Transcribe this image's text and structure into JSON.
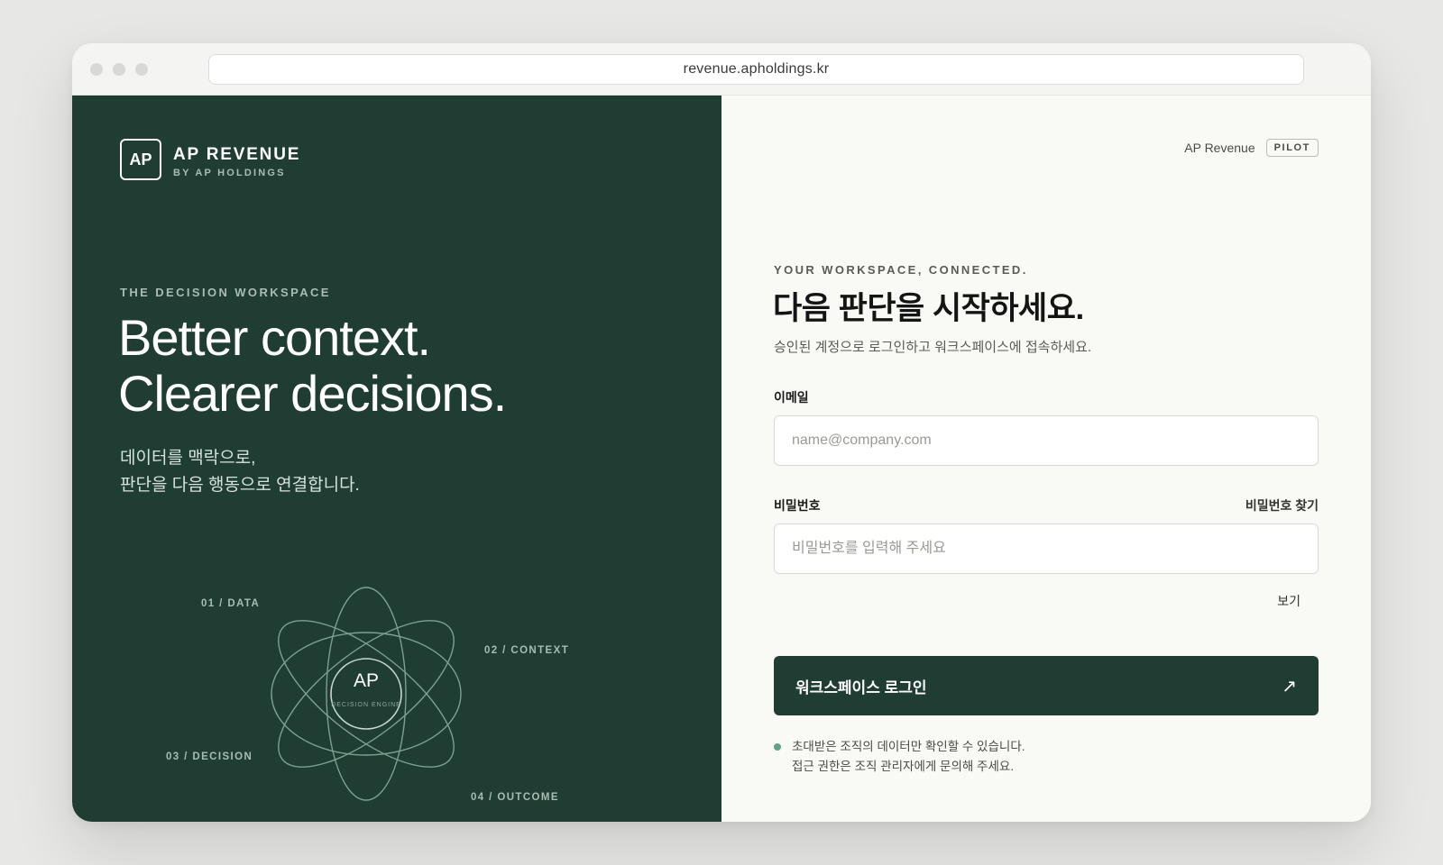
{
  "browser": {
    "url": "revenue.apholdings.kr"
  },
  "brand": {
    "mark": "AP",
    "name": "AP REVENUE",
    "sub": "BY AP HOLDINGS"
  },
  "left": {
    "eyebrow": "THE DECISION WORKSPACE",
    "hero_line1": "Better context.",
    "hero_line2": "Clearer decisions.",
    "desc_line1": "데이터를 맥락으로,",
    "desc_line2": "판단을 다음 행동으로 연결합니다.",
    "diagram": {
      "core": "AP",
      "core_sub": "DECISION ENGINE",
      "labels": [
        "01 / DATA",
        "02 / CONTEXT",
        "03 / DECISION",
        "04 / OUTCOME"
      ]
    }
  },
  "right": {
    "product": "AP Revenue",
    "badge": "PILOT",
    "eyebrow": "YOUR WORKSPACE, CONNECTED.",
    "title": "다음 판단을 시작하세요.",
    "subtitle": "승인된 계정으로 로그인하고 워크스페이스에 접속하세요.",
    "email_label": "이메일",
    "email_placeholder": "name@company.com",
    "email_value": "",
    "password_label": "비밀번호",
    "forgot_link": "비밀번호 찾기",
    "password_placeholder": "비밀번호를 입력해 주세요",
    "password_value": "",
    "show_toggle": "보기",
    "login_button": "워크스페이스 로그인",
    "login_arrow": "↗",
    "note_line1": "초대받은 조직의 데이터만 확인할 수 있습니다.",
    "note_line2": "접근 권한은 조직 관리자에게 문의해 주세요."
  },
  "colors": {
    "primary_green": "#1f3d33",
    "accent_green": "#5fa486",
    "panel_bg": "#f9f9f5"
  },
  "icons": {
    "window_controls": "traffic-light-dots",
    "login_arrow": "arrow-up-right-icon"
  }
}
